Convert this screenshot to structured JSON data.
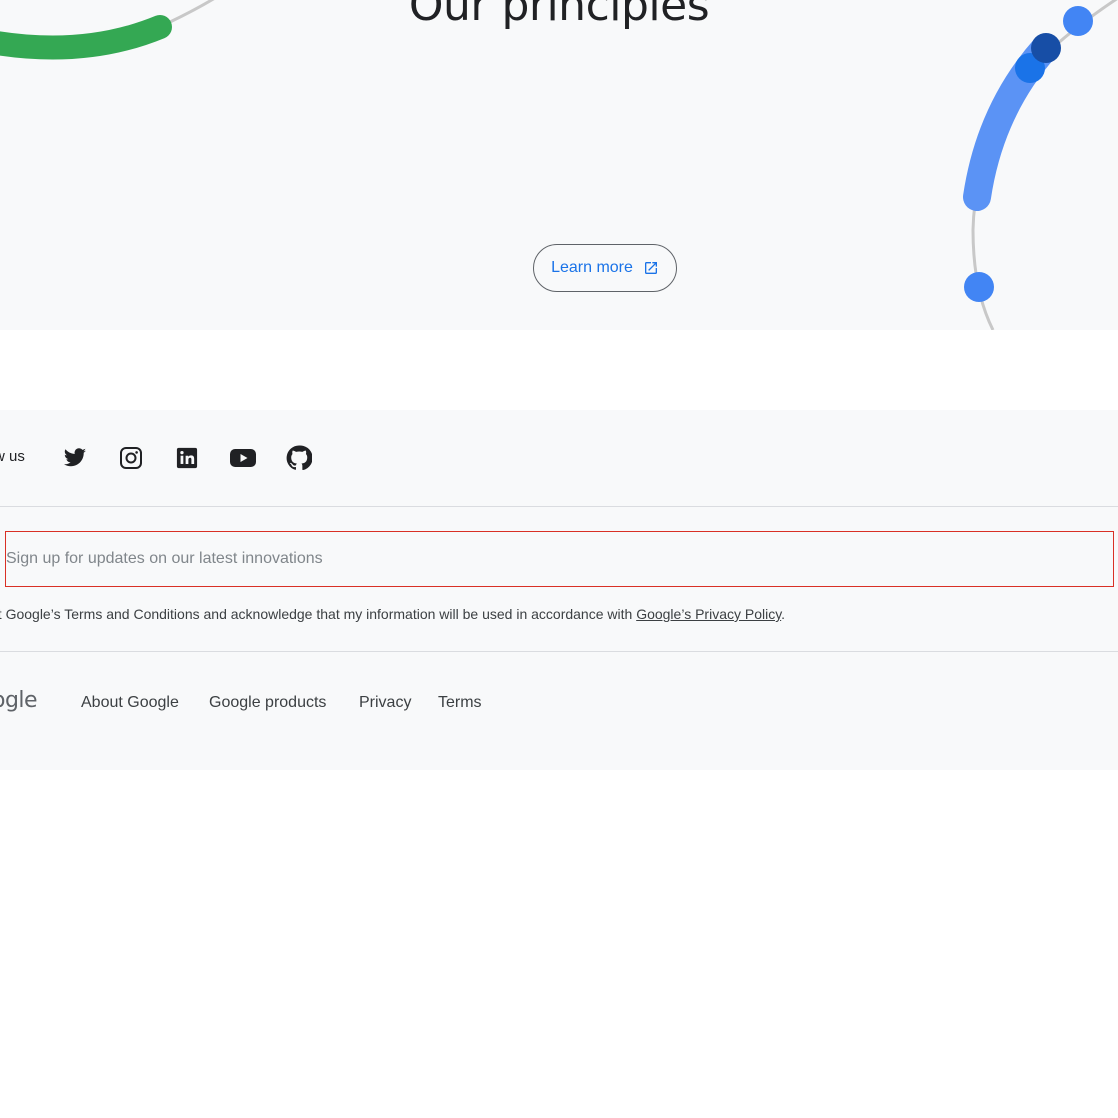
{
  "hero": {
    "title": "Our principles",
    "learn_more_label": "Learn more",
    "learn_more_icon": "external-link-icon",
    "colors": {
      "accent_blue": "#1a73e8",
      "deco_green": "#34a853",
      "deco_blue": "#4285f4",
      "deco_dark_blue": "#174ea6"
    }
  },
  "footer": {
    "follow_label": "w us",
    "social": [
      {
        "name": "twitter-icon"
      },
      {
        "name": "instagram-icon"
      },
      {
        "name": "linkedin-icon"
      },
      {
        "name": "youtube-icon"
      },
      {
        "name": "github-icon"
      }
    ],
    "signup": {
      "placeholder": "Sign up for updates on our latest innovations",
      "error_border_color": "#d93025"
    },
    "consent": {
      "text": "pt Google’s Terms and Conditions and acknowledge that my information will be used in accordance with ",
      "policy_link": "Google’s Privacy Policy",
      "suffix": "."
    },
    "logo_text": "ogle",
    "links": [
      "About Google",
      "Google products",
      "Privacy",
      "Terms"
    ]
  }
}
